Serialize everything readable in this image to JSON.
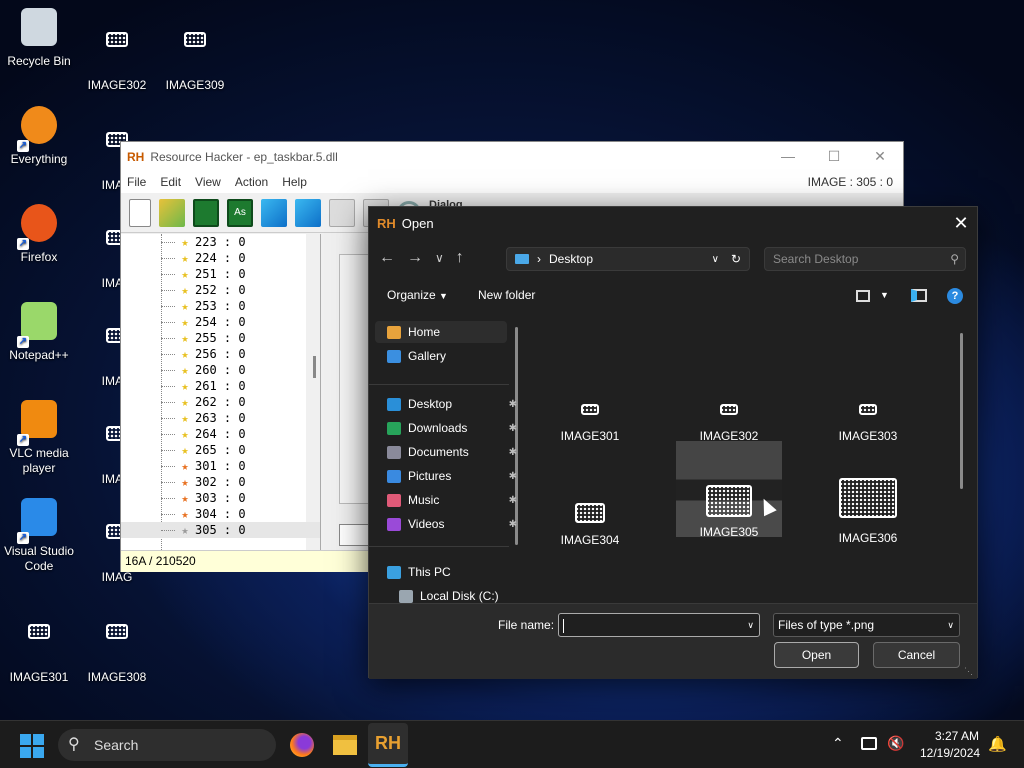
{
  "desktop": {
    "icons": [
      {
        "label": "Recycle Bin",
        "icon": "recycle-bin-icon"
      },
      {
        "label": "IMAGE302",
        "icon": "keyboard-icon"
      },
      {
        "label": "IMAGE309",
        "icon": "keyboard-icon"
      },
      {
        "label": "Everything",
        "icon": "everything-search-icon"
      },
      {
        "label": "IMAG",
        "icon": "keyboard-icon"
      },
      {
        "label": "Firefox",
        "icon": "firefox-icon"
      },
      {
        "label": "IMAG",
        "icon": "keyboard-icon"
      },
      {
        "label": "Notepad++",
        "icon": "notepadpp-icon"
      },
      {
        "label": "IMAG",
        "icon": "keyboard-icon"
      },
      {
        "label": "VLC media player",
        "icon": "vlc-icon"
      },
      {
        "label": "IMAG",
        "icon": "keyboard-icon"
      },
      {
        "label": "Visual Studio Code",
        "icon": "vscode-icon"
      },
      {
        "label": "IMAG",
        "icon": "keyboard-icon"
      },
      {
        "label": "IMAGE301",
        "icon": "keyboard-icon"
      },
      {
        "label": "IMAGE308",
        "icon": "keyboard-icon"
      }
    ]
  },
  "rh": {
    "title": "Resource Hacker - ep_taskbar.5.dll",
    "logo": "RH",
    "menu": [
      "File",
      "Edit",
      "View",
      "Action",
      "Help"
    ],
    "status_right": "IMAGE : 305 : 0",
    "toolbar_text": "Dialog",
    "tree": [
      {
        "label": "223 : 0",
        "star": "yellow"
      },
      {
        "label": "224 : 0",
        "star": "yellow"
      },
      {
        "label": "251 : 0",
        "star": "yellow"
      },
      {
        "label": "252 : 0",
        "star": "yellow"
      },
      {
        "label": "253 : 0",
        "star": "yellow"
      },
      {
        "label": "254 : 0",
        "star": "yellow"
      },
      {
        "label": "255 : 0",
        "star": "yellow"
      },
      {
        "label": "256 : 0",
        "star": "yellow"
      },
      {
        "label": "260 : 0",
        "star": "yellow"
      },
      {
        "label": "261 : 0",
        "star": "yellow"
      },
      {
        "label": "262 : 0",
        "star": "yellow"
      },
      {
        "label": "263 : 0",
        "star": "yellow"
      },
      {
        "label": "264 : 0",
        "star": "yellow"
      },
      {
        "label": "265 : 0",
        "star": "yellow"
      },
      {
        "label": "301 : 0",
        "star": "orange"
      },
      {
        "label": "302 : 0",
        "star": "orange"
      },
      {
        "label": "303 : 0",
        "star": "orange"
      },
      {
        "label": "304 : 0",
        "star": "orange"
      },
      {
        "label": "305 : 0",
        "star": "grey"
      }
    ],
    "bottom_status": "16A / 210520"
  },
  "dialog": {
    "title": "Open",
    "logo": "RH",
    "address": "Desktop",
    "search_placeholder": "Search Desktop",
    "organize": "Organize",
    "new_folder": "New folder",
    "nav_items": [
      {
        "label": "Home",
        "icon": "home-icon",
        "color": "#e8a33c",
        "pinned": false
      },
      {
        "label": "Gallery",
        "icon": "gallery-icon",
        "color": "#3b8fe0",
        "pinned": false
      },
      {
        "label": "Desktop",
        "icon": "desktop-icon",
        "color": "#2a8fd8",
        "pinned": true
      },
      {
        "label": "Downloads",
        "icon": "downloads-icon",
        "color": "#27a35a",
        "pinned": true
      },
      {
        "label": "Documents",
        "icon": "documents-icon",
        "color": "#8a8a9a",
        "pinned": true
      },
      {
        "label": "Pictures",
        "icon": "pictures-icon",
        "color": "#3a8ae0",
        "pinned": true
      },
      {
        "label": "Music",
        "icon": "music-icon",
        "color": "#e05a78",
        "pinned": true
      },
      {
        "label": "Videos",
        "icon": "videos-icon",
        "color": "#9a4ad8",
        "pinned": true
      },
      {
        "label": "This PC",
        "icon": "this-pc-icon",
        "color": "#3aa0e0",
        "pinned": false
      },
      {
        "label": "Local Disk (C:)",
        "icon": "local-disk-icon",
        "color": "#9aa6b0",
        "pinned": false
      }
    ],
    "files": [
      {
        "label": "IMAGE301",
        "size": "small"
      },
      {
        "label": "IMAGE302",
        "size": "small"
      },
      {
        "label": "IMAGE303",
        "size": "small"
      },
      {
        "label": "IMAGE304",
        "size": "medium"
      },
      {
        "label": "IMAGE305",
        "size": "large",
        "selected": true
      },
      {
        "label": "IMAGE306",
        "size": "xlarge"
      }
    ],
    "file_name_label": "File name:",
    "file_name_value": "",
    "file_type": "Files of type *.png",
    "open_label": "Open",
    "cancel_label": "Cancel"
  },
  "taskbar": {
    "search_label": "Search",
    "time": "3:27 AM",
    "date": "12/19/2024"
  }
}
